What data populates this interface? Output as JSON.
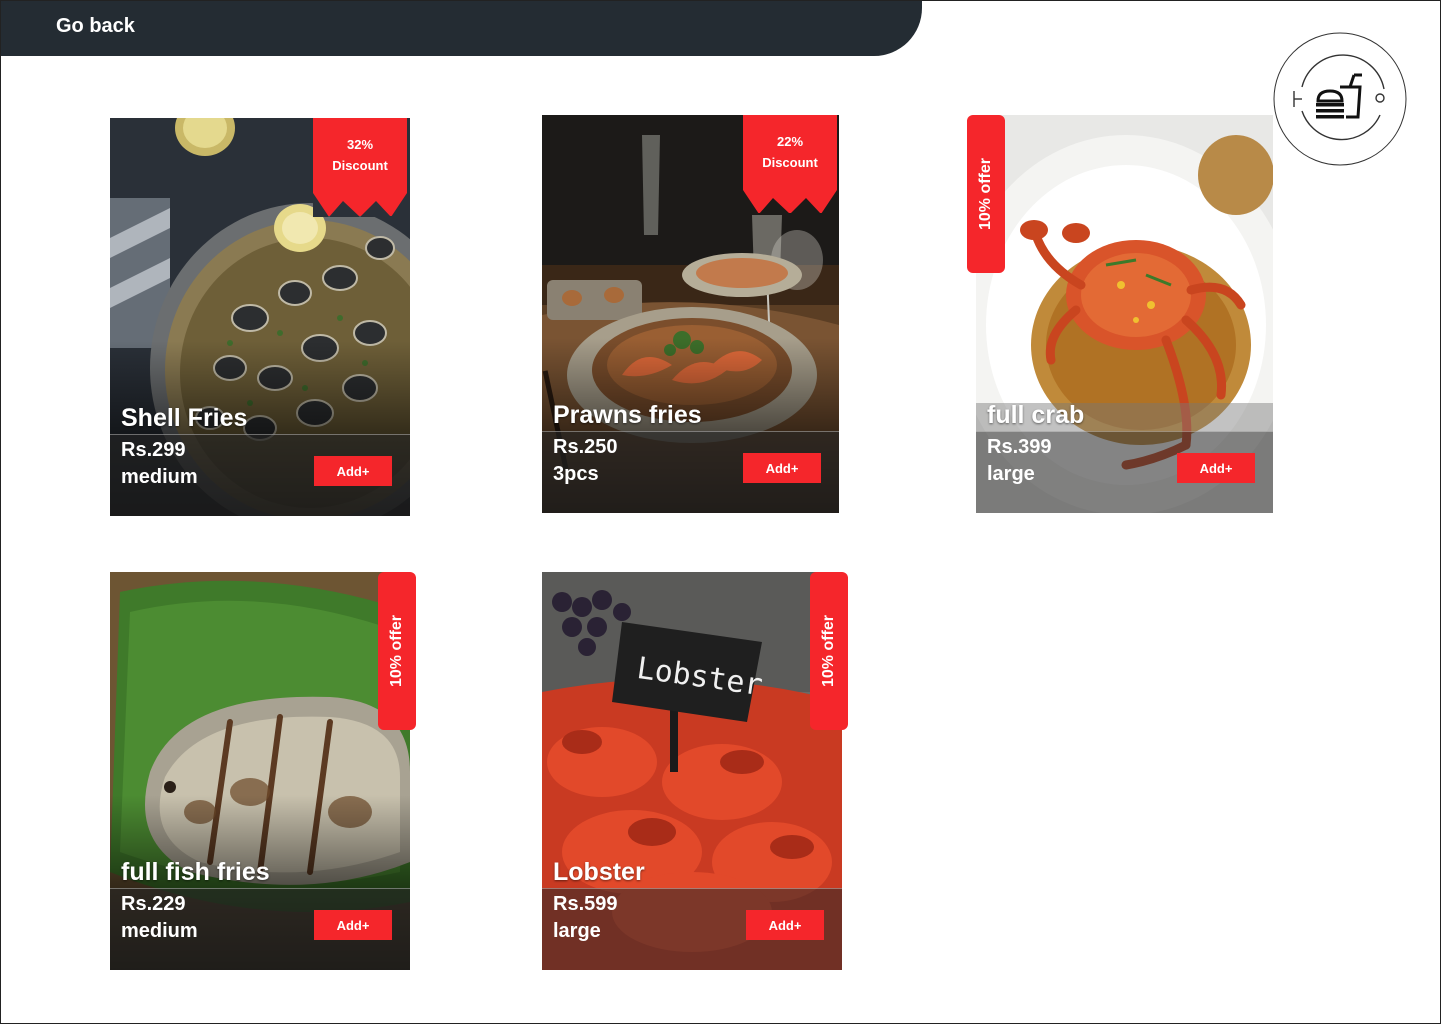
{
  "header": {
    "back_label": "Go back"
  },
  "colors": {
    "topbar": "#242c33",
    "accent": "#f5262b",
    "page": "#ffffff"
  },
  "logo": {
    "icon": "burger-drink-icon"
  },
  "items": [
    {
      "name": "Shell Fries",
      "price": "Rs.299",
      "size": "medium",
      "add_label": "Add+",
      "badge_line1": "32%",
      "badge_line2": "Discount",
      "image": "clams-in-pan-photo"
    },
    {
      "name": "Prawns fries",
      "price": "Rs.250",
      "size": "3pcs",
      "add_label": "Add+",
      "badge_line1": "22%",
      "badge_line2": "Discount",
      "image": "prawns-noodles-photo"
    },
    {
      "name": "full crab",
      "price": "Rs.399",
      "size": "large",
      "add_label": "Add+",
      "badge": "10% offer",
      "image": "crab-plate-photo"
    },
    {
      "name": "full fish fries",
      "price": "Rs.229",
      "size": "medium",
      "add_label": "Add+",
      "badge": "10% offer",
      "image": "grilled-fish-photo"
    },
    {
      "name": "Lobster",
      "price": "Rs.599",
      "size": "large",
      "add_label": "Add+",
      "badge": "10% offer",
      "image": "lobsters-photo",
      "sign_text": "Lobster"
    }
  ]
}
